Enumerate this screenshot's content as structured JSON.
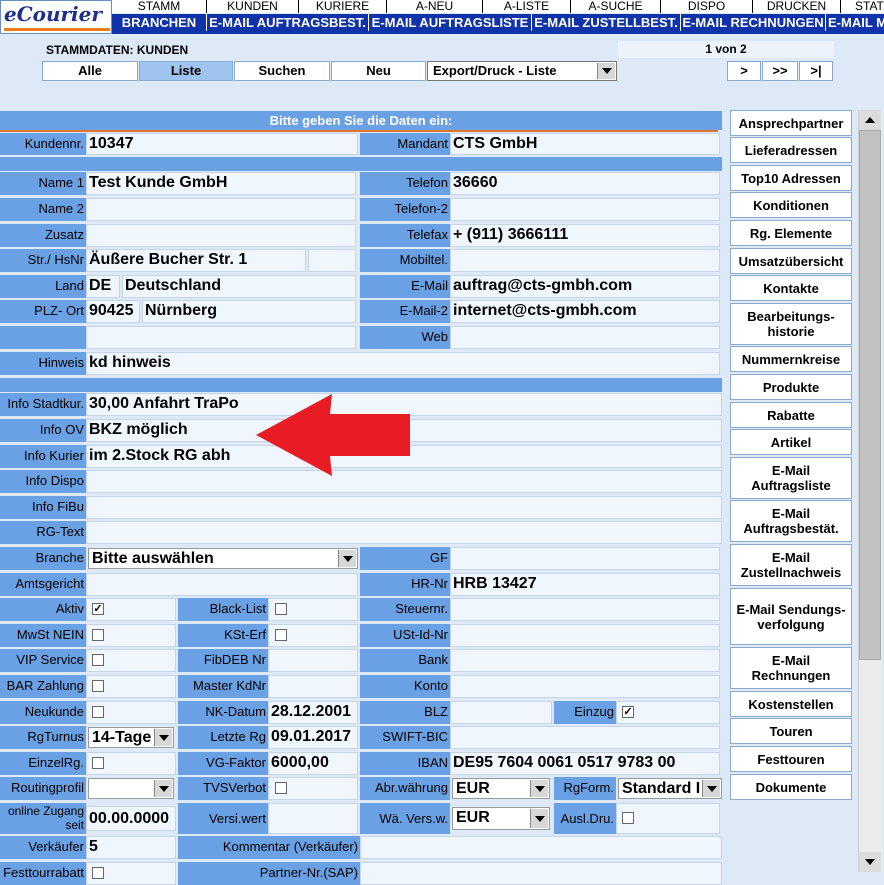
{
  "app": {
    "logo": "eCourier"
  },
  "nav": {
    "top": [
      "STAMM",
      "KUNDEN",
      "KURIERE",
      "A-NEU",
      "A-LISTE",
      "A-SUCHE",
      "DISPO",
      "DRUCKEN",
      "STAT"
    ],
    "sub": [
      "BRANCHEN",
      "E-MAIL AUFTRAGSBEST.",
      "E-MAIL AUFTRAGSLISTE",
      "E-MAIL ZUSTELLBEST.",
      "E-MAIL RECHNUNGEN",
      "E-MAIL M"
    ]
  },
  "header": {
    "title": "STAMMDATEN: KUNDEN",
    "page_info": "1 von 2",
    "buttons": [
      "Alle",
      "Liste",
      "Suchen",
      "Neu"
    ],
    "export_select": "Export/Druck - Liste",
    "nav_buttons": [
      ">",
      ">>",
      ">|"
    ]
  },
  "form": {
    "banner": "Bitte geben Sie die Daten ein:",
    "labels": {
      "kundennr": "Kundennr.",
      "mandant": "Mandant",
      "name1": "Name 1",
      "telefon": "Telefon",
      "name2": "Name 2",
      "telefon2": "Telefon-2",
      "zusatz": "Zusatz",
      "telefax": "Telefax",
      "str": "Str./ HsNr",
      "mobil": "Mobiltel.",
      "land": "Land",
      "email": "E-Mail",
      "plz": "PLZ- Ort",
      "email2": "E-Mail-2",
      "web": "Web",
      "hinweis": "Hinweis",
      "info_stadt": "Info Stadtkur.",
      "info_ov": "Info OV",
      "info_kurier": "Info Kurier",
      "info_dispo": "Info Dispo",
      "info_fibu": "Info FiBu",
      "rg_text": "RG-Text",
      "branche": "Branche",
      "gf": "GF",
      "amtsgericht": "Amtsgericht",
      "hr_nr": "HR-Nr",
      "aktiv": "Aktiv",
      "black_list": "Black-List",
      "steuernr": "Steuernr.",
      "mwst": "MwSt NEIN",
      "kst_erf": "KSt-Erf",
      "ust_id": "USt-Id-Nr",
      "vip": "VIP Service",
      "fibdeb": "FibDEB Nr",
      "bank": "Bank",
      "bar": "BAR Zahlung",
      "master_kdnr": "Master KdNr",
      "konto": "Konto",
      "neukunde": "Neukunde",
      "nk_datum": "NK-Datum",
      "blz": "BLZ",
      "einzug": "Einzug",
      "rgturnus": "RgTurnus",
      "letzte_rg": "Letzte Rg",
      "swift": "SWIFT-BIC",
      "einzelrg": "EinzelRg.",
      "vg_faktor": "VG-Faktor",
      "iban": "IBAN",
      "routingprofil": "Routingprofil",
      "tvsverbot": "TVSVerbot",
      "abr_waehrung": "Abr.währung",
      "rgform": "RgForm.",
      "online_zugang": "online Zugang seit",
      "versi_wert": "Versi.wert",
      "wae_vers": "Wä. Vers.w.",
      "ausl_dru": "Ausl.Dru.",
      "verkaeufer": "Verkäufer",
      "kommentar": "Kommentar (Verkäufer)",
      "festtourrabatt": "Festtourrabatt",
      "partner_nr": "Partner-Nr.(SAP)"
    },
    "values": {
      "kundennr": "10347",
      "mandant": "CTS GmbH",
      "name1": "Test Kunde GmbH",
      "telefon": "36660",
      "telefax": "+ (911) 3666111",
      "str": "Äußere Bucher Str. 1",
      "land_code": "DE",
      "land_name": "Deutschland",
      "email": "auftrag@cts-gmbh.com",
      "plz": "90425",
      "ort": "Nürnberg",
      "email2": "internet@cts-gmbh.com",
      "hinweis": "kd hinweis",
      "info_stadt": "30,00 Anfahrt TraPo",
      "info_ov": "BKZ möglich",
      "info_kurier": "im 2.Stock RG abh",
      "branche": "Bitte auswählen",
      "hr_nr": "HRB 13427",
      "nk_datum": "28.12.2001",
      "rgturnus": "14-Tage",
      "letzte_rg": "09.01.2017",
      "vg_faktor": "6000,00",
      "iban": "DE95 7604 0061 0517 9783 00",
      "abr_waehrung": "EUR",
      "rgform": "Standard I",
      "online_zugang": "00.00.0000",
      "wae_vers": "EUR",
      "verkaeufer": "5"
    },
    "checked": {
      "aktiv": true,
      "einzug": true
    }
  },
  "side_menu": [
    "Ansprechpartner",
    "Lieferadressen",
    "Top10 Adressen",
    "Konditionen",
    "Rg. Elemente",
    "Umsatzübersicht",
    "Kontakte",
    "Bearbeitungs- historie",
    "Nummernkreise",
    "Produkte",
    "Rabatte",
    "Artikel",
    "E-Mail Auftragsliste",
    "E-Mail Auftragsbestät.",
    "E-Mail Zustellnachweis",
    "E-Mail Sendungs- verfolgung",
    "E-Mail Rechnungen",
    "Kostenstellen",
    "Touren",
    "Festtouren",
    "Dokumente"
  ],
  "colors": {
    "label_bg": "#6aa1e4",
    "nav_blue": "#1133aa",
    "accent_orange": "#e0742a",
    "arrow_red": "#e81c24"
  }
}
